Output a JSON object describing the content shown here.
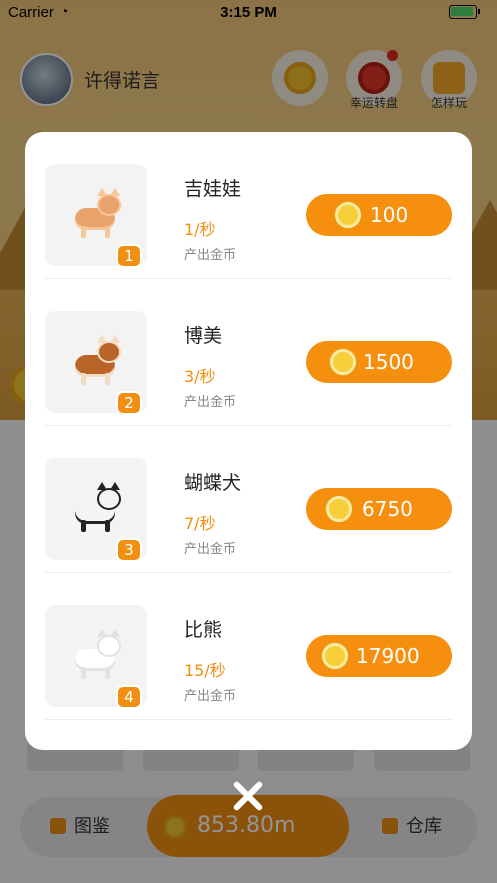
{
  "status_bar": {
    "carrier": "Carrier",
    "time": "3:15 PM"
  },
  "header": {
    "username": "许得诺言"
  },
  "top_buttons": [
    {
      "icon": "gold-coin-icon",
      "label": ""
    },
    {
      "icon": "lucky-wheel-icon",
      "label": "幸运转盘",
      "has_notification_dot": true
    },
    {
      "icon": "help-book-icon",
      "label": "怎样玩"
    }
  ],
  "bottom_bar": {
    "left_label": "图鉴",
    "money": "853.80m",
    "right_label": "仓库"
  },
  "shop": {
    "items": [
      {
        "level": "1",
        "name": "吉娃娃",
        "rate": "1/秒",
        "desc": "产出金币",
        "price": "100",
        "color": "#e9a36a",
        "accent": "#f7c59a"
      },
      {
        "level": "2",
        "name": "博美",
        "rate": "3/秒",
        "desc": "产出金币",
        "price": "1500",
        "color": "#b9652a",
        "accent": "#f2dcc2"
      },
      {
        "level": "3",
        "name": "蝴蝶犬",
        "rate": "7/秒",
        "desc": "产出金币",
        "price": "6750",
        "color": "#f4f4f4",
        "accent": "#222222"
      },
      {
        "level": "4",
        "name": "比熊",
        "rate": "15/秒",
        "desc": "产出金币",
        "price": "17900",
        "color": "#ffffff",
        "accent": "#e2e2e2"
      }
    ]
  },
  "colors": {
    "accent": "#f08f12",
    "coin": "#f7c531"
  }
}
